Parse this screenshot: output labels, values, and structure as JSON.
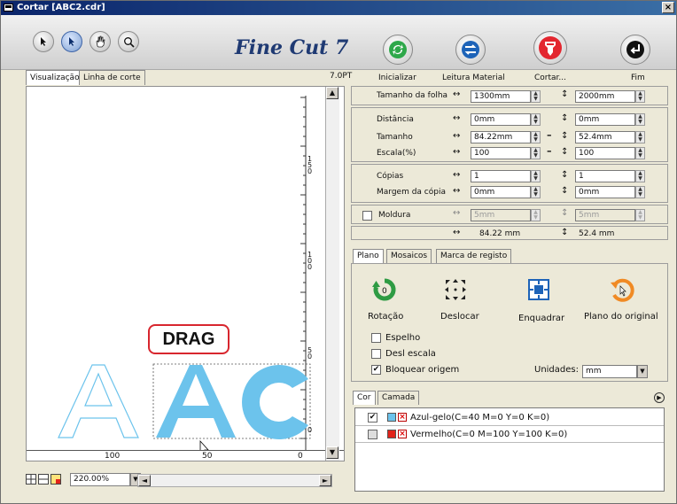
{
  "window": {
    "title": "Cortar [ABC2.cdr]",
    "close": "×"
  },
  "toolbar": {
    "logo": "Fine Cut 7",
    "buttons": [
      {
        "label": "Inicializar"
      },
      {
        "label": "Leitura Material"
      },
      {
        "label": "Cortar..."
      },
      {
        "label": "Fim"
      }
    ]
  },
  "preview": {
    "tabs": [
      "Visualização",
      "Linha de corte"
    ],
    "pt_size": "7.0PT",
    "drag_label": "DRAG",
    "ruler_h_labels": [
      "100",
      "50",
      "0"
    ],
    "ruler_v_labels": [
      "150",
      "100",
      "50",
      "0"
    ],
    "zoom": "220.00%",
    "letters": [
      "A",
      "A",
      "C"
    ]
  },
  "settings": {
    "sheet_size": {
      "label": "Tamanho da folha",
      "w": "1300mm",
      "h": "2000mm"
    },
    "distance": {
      "label": "Distância",
      "x": "0mm",
      "y": "0mm"
    },
    "size": {
      "label": "Tamanho",
      "x": "84.22mm",
      "y": "52.4mm"
    },
    "scale": {
      "label": "Escala(%)",
      "x": "100",
      "y": "100"
    },
    "copies": {
      "label": "Cópias",
      "x": "1",
      "y": "1"
    },
    "copy_margin": {
      "label": "Margem da cópia",
      "x": "0mm",
      "y": "0mm"
    },
    "frame": {
      "label": "Moldura",
      "x": "5mm",
      "y": "5mm"
    },
    "total": {
      "x": "84.22 mm",
      "y": "52.4 mm"
    }
  },
  "plano": {
    "tabs": [
      "Plano",
      "Mosaicos",
      "Marca de registo"
    ],
    "actions": [
      "Rotação",
      "Deslocar",
      "Enquadrar",
      "Plano do original"
    ],
    "rotation_value": "0",
    "checks": [
      {
        "label": "Espelho",
        "checked": false
      },
      {
        "label": "Desl escala",
        "checked": false
      },
      {
        "label": "Bloquear origem",
        "checked": true
      }
    ],
    "units_label": "Unidades:",
    "units_value": "mm"
  },
  "layers": {
    "tabs": [
      "Cor",
      "Camada"
    ],
    "rows": [
      {
        "label": "Azul-gelo(C=40 M=0 Y=0 K=0)",
        "color": "#6cc3ec",
        "checked": true
      },
      {
        "label": "Vermelho(C=0 M=100 Y=100 K=0)",
        "color": "#e2231a",
        "checked": false
      }
    ]
  },
  "colors": {
    "accent_blue": "#6cc3ec",
    "drag_border": "#d8262e",
    "title_bar": "#0a246a"
  }
}
